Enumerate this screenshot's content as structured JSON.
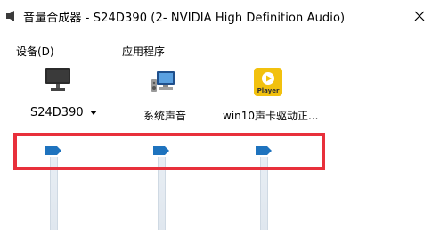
{
  "window": {
    "title": "音量合成器 - S24D390 (2- NVIDIA High Definition Audio)",
    "close_icon": "close-icon"
  },
  "sections": {
    "device_label": "设备(D)",
    "apps_label": "应用程序"
  },
  "device": {
    "name": "S24D390",
    "icon": "monitor-icon",
    "volume": 1.0
  },
  "apps": [
    {
      "label": "系统声音",
      "icon": "system-sounds-icon",
      "volume": 1.0
    },
    {
      "label": "win10声卡驱动正...",
      "icon": "player-icon",
      "icon_text": "Player",
      "volume": 1.0
    }
  ],
  "colors": {
    "highlight": "#e8303b",
    "thumb": "#1e73be",
    "player_bg": "#f2c10e"
  }
}
